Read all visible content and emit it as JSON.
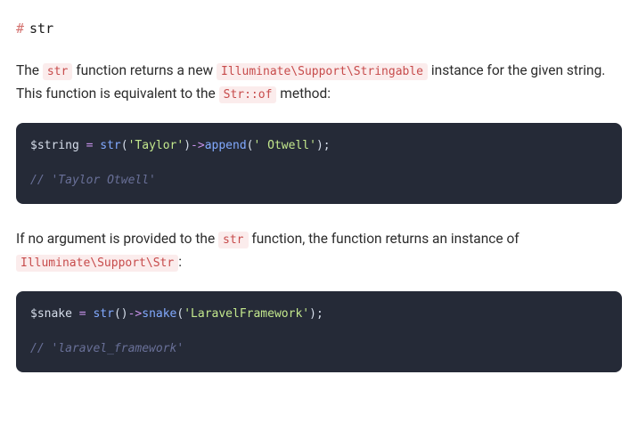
{
  "heading": {
    "hash": "#",
    "title": "str"
  },
  "paragraphs": {
    "p1_part1": "The ",
    "p1_code1": "str",
    "p1_part2": " function returns a new ",
    "p1_code2": "Illuminate\\Support\\Stringable",
    "p1_part3": " instance for the given string. This function is equivalent to the ",
    "p1_code3": "Str::of",
    "p1_part4": " method:",
    "p2_part1": "If no argument is provided to the ",
    "p2_code1": "str",
    "p2_part2": " function, the function returns an instance of ",
    "p2_code2": "Illuminate\\Support\\Str",
    "p2_part3": ":"
  },
  "code1": {
    "line1": {
      "var": "$string",
      "sp1": " ",
      "eq": "=",
      "sp2": " ",
      "func": "str",
      "open1": "(",
      "str1": "'Taylor'",
      "close1": ")",
      "arrow": "->",
      "method": "append",
      "open2": "(",
      "str2": "' Otwell'",
      "close2": ")",
      "semi": ";"
    },
    "line3": {
      "comment": "// 'Taylor Otwell'"
    }
  },
  "code2": {
    "line1": {
      "var": "$snake",
      "sp1": " ",
      "eq": "=",
      "sp2": " ",
      "func": "str",
      "open1": "(",
      "close1": ")",
      "arrow": "->",
      "method": "snake",
      "open2": "(",
      "str1": "'LaravelFramework'",
      "close2": ")",
      "semi": ";"
    },
    "line3": {
      "comment": "// 'laravel_framework'"
    }
  }
}
